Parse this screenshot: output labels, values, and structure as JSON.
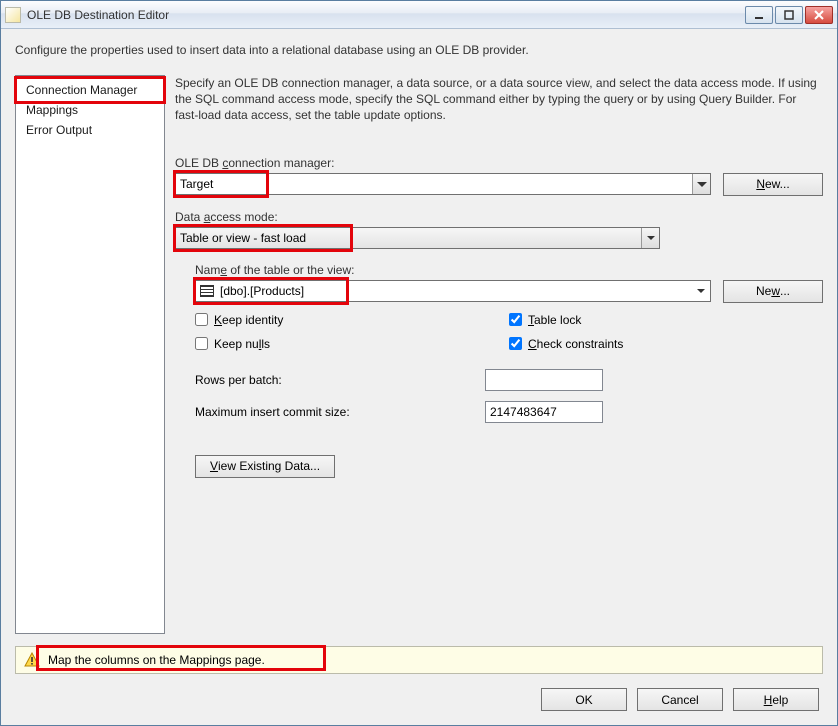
{
  "window": {
    "title": "OLE DB Destination Editor"
  },
  "description": "Configure the properties used to insert data into a relational database using an OLE DB provider.",
  "sidebar": {
    "items": [
      "Connection Manager",
      "Mappings",
      "Error Output"
    ]
  },
  "instructions": "Specify an OLE DB connection manager, a data source, or a data source view, and select the data access mode. If using the SQL command access mode, specify the SQL command either by typing the query or by using Query Builder. For fast-load data access, set the table update options.",
  "labels": {
    "connMgr_pre": "OLE DB ",
    "connMgr_u": "c",
    "connMgr_post": "onnection manager:",
    "accessMode_pre": "Data ",
    "accessMode_u": "a",
    "accessMode_post": "ccess mode:",
    "tableName_pre": "Nam",
    "tableName_u": "e",
    "tableName_post": " of the table or the view:",
    "keepIdentity_u": "K",
    "keepIdentity_post": "eep identity",
    "keepNulls_pre": "Keep nu",
    "keepNulls_u": "l",
    "keepNulls_post": "ls",
    "tableLock_u": "T",
    "tableLock_post": "able lock",
    "checkConstraints_u": "C",
    "checkConstraints_post": "heck constraints",
    "rowsPerBatch_u": "R",
    "rowsPerBatch_post": "ows per batch:",
    "maxCommit_u": "M",
    "maxCommit_post": "aximum insert commit size:"
  },
  "values": {
    "connectionManager": "Target",
    "dataAccessMode": "Table or view - fast load",
    "tableName": "[dbo].[Products]",
    "keepIdentity": false,
    "keepNulls": false,
    "tableLock": true,
    "checkConstraints": true,
    "rowsPerBatch": "",
    "maxInsertCommitSize": "2147483647"
  },
  "buttons": {
    "new_u": "N",
    "new_post": "ew...",
    "new2_pre": "Ne",
    "new2_u": "w",
    "new2_post": "...",
    "viewExisting_u": "V",
    "viewExisting_post": "iew Existing Data...",
    "ok": "OK",
    "cancel": "Cancel",
    "help_u": "H",
    "help_post": "elp"
  },
  "warning": {
    "text": "Map the columns on the Mappings page."
  }
}
